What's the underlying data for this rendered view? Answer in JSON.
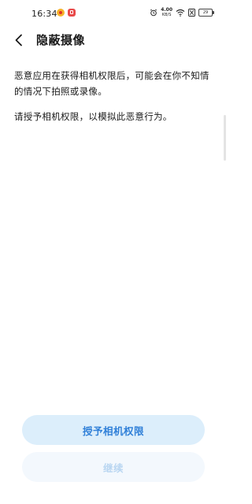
{
  "status_bar": {
    "time": "16:34",
    "net_speed_value": "4.00",
    "net_speed_unit": "KB/S",
    "battery_level": "29",
    "notifications": [
      "weibo-icon",
      "red-app-icon"
    ],
    "status_icons": [
      "alarm-icon",
      "wifi-icon",
      "sim-disabled-icon",
      "battery-icon"
    ]
  },
  "header": {
    "back_icon": "chevron-left-icon",
    "title": "隐蔽摄像"
  },
  "content": {
    "paragraph_1": "恶意应用在获得相机权限后，可能会在你不知情的情况下拍照或录像。",
    "paragraph_2": "请授予相机权限，以模拟此恶意行为。"
  },
  "actions": {
    "grant_label": "授予相机权限",
    "continue_label": "继续",
    "continue_disabled": true
  },
  "colors": {
    "primary_text": "#2f7fd8",
    "primary_bg": "#dceefb",
    "disabled_text": "#b9d6f1",
    "disabled_bg": "#f3f8fd"
  }
}
